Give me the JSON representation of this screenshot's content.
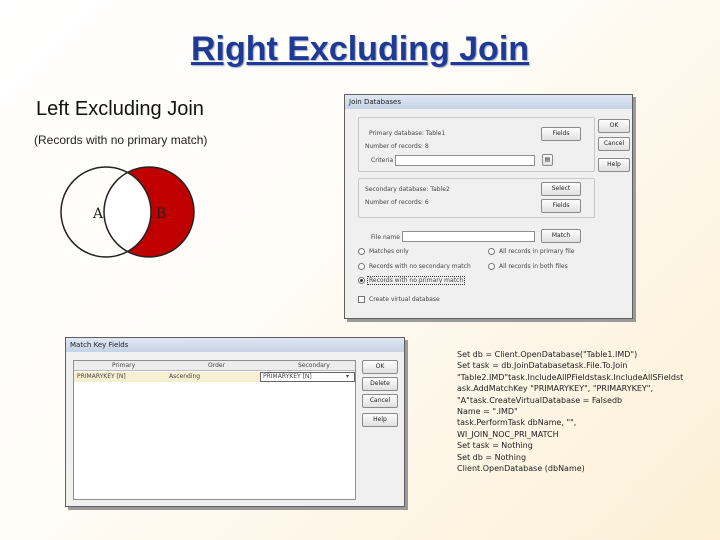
{
  "title": "Right Excluding Join",
  "subtitle": "Left Excluding Join",
  "caption": "(Records with no primary match)",
  "venn": {
    "label_a": "A",
    "label_b": "B",
    "fill_color": "#c00000"
  },
  "join_dialog": {
    "title": "Join Databases",
    "primary_db": "Primary database: Table1",
    "primary_records": "Number of records: 8",
    "criteria_label": "Criteria",
    "secondary_db": "Secondary database: Table2",
    "secondary_records": "Number of records: 6",
    "file_name_label": "File name",
    "buttons": {
      "fields": "Fields",
      "ok": "OK",
      "cancel": "Cancel",
      "help": "Help",
      "select": "Select",
      "fields2": "Fields",
      "match": "Match"
    },
    "options": {
      "matches_only": "Matches only",
      "no_secondary": "Records with no secondary match",
      "no_primary": "Records with no primary match",
      "all_primary": "All records in primary file",
      "all_both": "All records in both files",
      "create_db": "Create virtual database"
    }
  },
  "match_dialog": {
    "title": "Match Key Fields",
    "headers": [
      "Primary",
      "Order",
      "Secondary"
    ],
    "row": [
      "PRIMARYKEY [N]",
      "Ascending",
      "PRIMARYKEY [N]"
    ],
    "buttons": {
      "ok": "OK",
      "delete": "Delete",
      "cancel": "Cancel",
      "help": "Help"
    }
  },
  "code_lines": [
    "Set db = Client.OpenDatabase(\"Table1.IMD\")",
    "Set task = db.JoinDatabasetask.File.To.Join",
    "\"Table2.IMD\"task.IncludeAllPFieldstask.IncludeAllSFieldst",
    "ask.AddMatchKey \"PRIMARYKEY\", \"PRIMARYKEY\",",
    "\"A\"task.CreateVirtualDatabase = Falsedb",
    "Name = \".IMD\"",
    "task.PerformTask dbName, \"\",",
    "WI_JOIN_NOC_PRI_MATCH",
    "Set task = Nothing",
    "Set db = Nothing",
    "Client.OpenDatabase (dbName)"
  ]
}
